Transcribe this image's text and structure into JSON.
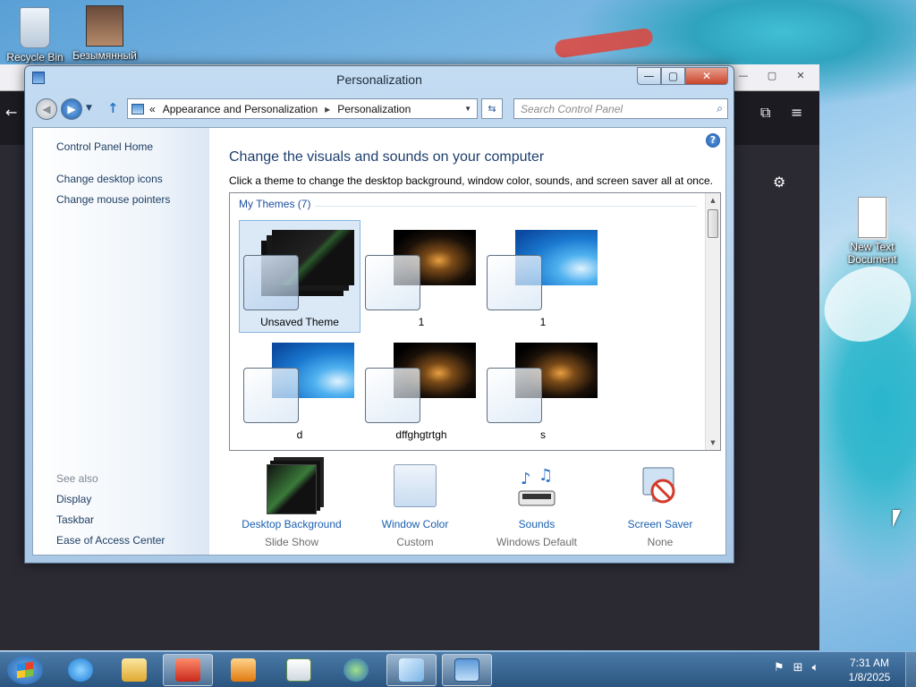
{
  "desktop": {
    "icons": [
      {
        "label": "Recycle Bin",
        "icon": "recycle-bin-icon"
      },
      {
        "label": "Безымянный",
        "icon": "user-photo-icon"
      },
      {
        "label": "New Text Document",
        "icon": "text-document-icon"
      }
    ]
  },
  "window": {
    "title": "Personalization",
    "buttons": {
      "minimize": "—",
      "maximize": "▢",
      "close": "✕"
    }
  },
  "nav": {
    "breadcrumb": [
      "Appearance and Personalization",
      "Personalization"
    ],
    "breadcrumb_prefix": "«",
    "breadcrumb_sep": "▸",
    "search_placeholder": "Search Control Panel"
  },
  "left_pane": {
    "links": [
      "Control Panel Home",
      "Change desktop icons",
      "Change mouse pointers"
    ],
    "see_also_label": "See also",
    "see_also": [
      "Display",
      "Taskbar",
      "Ease of Access Center"
    ]
  },
  "content": {
    "heading": "Change the visuals and sounds on your computer",
    "subline": "Click a theme to change the desktop background, window color, sounds, and screen saver all at once.",
    "group_title": "My Themes (7)",
    "themes": [
      {
        "name": "Unsaved Theme",
        "background": "stack",
        "selected": true
      },
      {
        "name": "1",
        "background": "dark",
        "selected": false
      },
      {
        "name": "1",
        "background": "blue",
        "selected": false
      },
      {
        "name": "d",
        "background": "blue",
        "selected": false
      },
      {
        "name": "dffghgtrtgh",
        "background": "dark",
        "selected": false
      },
      {
        "name": "s",
        "background": "dark",
        "selected": false
      }
    ],
    "settings": [
      {
        "title": "Desktop Background",
        "value": "Slide Show",
        "icon": "desktop-background-icon"
      },
      {
        "title": "Window Color",
        "value": "Custom",
        "icon": "window-color-icon"
      },
      {
        "title": "Sounds",
        "value": "Windows Default",
        "icon": "sounds-icon"
      },
      {
        "title": "Screen Saver",
        "value": "None",
        "icon": "screen-saver-icon"
      }
    ]
  },
  "taskbar": {
    "apps": [
      "internet-explorer-icon",
      "file-explorer-icon",
      "app-red-icon",
      "media-player-icon",
      "document-icon",
      "globe-icon",
      "glass-app-icon",
      "control-panel-icon"
    ],
    "active_index": 7,
    "time": "7:31 AM",
    "date": "1/8/2025"
  },
  "colors": {
    "link": "#1f3e63",
    "heading": "#1e3f6e",
    "settings_link": "#1a5fb0"
  }
}
